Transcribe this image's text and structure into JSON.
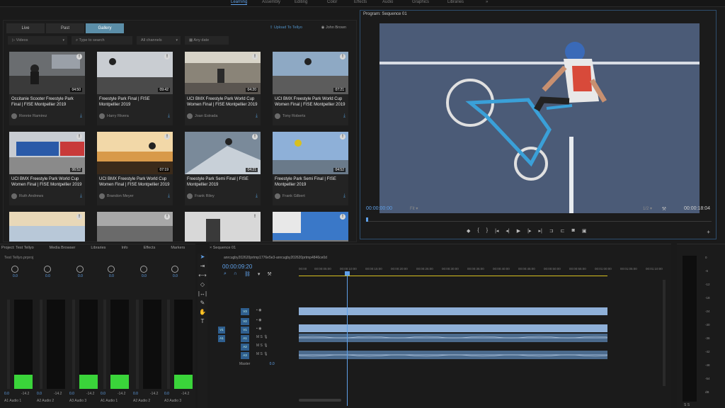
{
  "workspaces": [
    "Learning",
    "Assembly",
    "Editing",
    "Color",
    "Effects",
    "Audio",
    "Graphics",
    "Libraries",
    "»"
  ],
  "media": {
    "tabs": [
      "Live",
      "Past",
      "Gallery"
    ],
    "upload_label": "Upload To Tellyo",
    "user_label": "John Brown",
    "filters": {
      "type": "Videos",
      "search_placeholder": "Type to search",
      "channels": "All channels",
      "date": "Any date"
    },
    "cards": [
      {
        "title": "Occitanie Scooter Freestyle Park Final | FISE Montpellier 2019",
        "author": "Ronnie Ramirez",
        "duration": "04:50"
      },
      {
        "title": "Freestyle Park Final | FISE Montpellier 2019",
        "author": "Harry Rivera",
        "duration": "09:42"
      },
      {
        "title": "UCI BMX Freestyle Park World Cup Women Final | FISE Montpellier 2019",
        "author": "Joan Estrada",
        "duration": "04:20"
      },
      {
        "title": "UCI BMX Freestyle Park World Cup Women Final | FISE Montpellier 2019",
        "author": "Tony Roberts",
        "duration": "07:21"
      },
      {
        "title": "UCI BMX Freestyle Park World Cup Women Final | FISE Montpellier 2019",
        "author": "Ruth Andrews",
        "duration": "06:52"
      },
      {
        "title": "UCI BMX Freestyle Park World Cup Women Final | FISE Montpellier 2019",
        "author": "Brandon Meyer",
        "duration": "07:19"
      },
      {
        "title": "Freestyle Park Semi Final | FISE Montpellier 2019",
        "author": "Frank Riley",
        "duration": "04:21"
      },
      {
        "title": "Freestyle Park Semi Final | FISE Montpellier 2019",
        "author": "Frank Gilbert",
        "duration": "04:52"
      },
      {
        "title": "",
        "author": "",
        "duration": ""
      },
      {
        "title": "",
        "author": "",
        "duration": ""
      },
      {
        "title": "",
        "author": "",
        "duration": ""
      },
      {
        "title": "",
        "author": "",
        "duration": ""
      }
    ]
  },
  "program": {
    "title": "Program: Sequence 01",
    "timecode": "00:00:00:00",
    "fit": "Fit",
    "resolution": "1/2",
    "duration": "00:00:18:04"
  },
  "mixer": {
    "tabs": [
      "Project: Test Tellyo",
      "Media Browser",
      "Libraries",
      "Info",
      "Effects",
      "Markers"
    ],
    "project_file": "Test Tellyo.prproj",
    "channels": [
      {
        "name": "Audio 1",
        "id": "A1",
        "knob": "0.0",
        "val": "0.0",
        "val2": "-14.2",
        "level": 0.16
      },
      {
        "name": "Audio 2",
        "id": "A2",
        "knob": "0.0",
        "val": "0.0",
        "val2": "-14.2",
        "level": 0.0
      },
      {
        "name": "Audio 3",
        "id": "A3",
        "knob": "0.0",
        "val": "0.0",
        "val2": "-14.2",
        "level": 0.16
      },
      {
        "name": "Audio 1",
        "id": "A1",
        "knob": "0.0",
        "val": "0.0",
        "val2": "-14.2",
        "level": 0.16
      },
      {
        "name": "Audio 2",
        "id": "A2",
        "knob": "0.0",
        "val": "0.0",
        "val2": "-14.2",
        "level": 0.0
      },
      {
        "name": "Audio 3",
        "id": "A3",
        "knob": "0.0",
        "val": "0.0",
        "val2": "-14.2",
        "level": 0.16
      }
    ]
  },
  "timeline": {
    "tab": "Sequence 01",
    "sequence_name": "anrcugby202620prtmp1776e5e3-anrcugby202620prtmp4846ce0d",
    "timecode": "00:00:09:20",
    "ruler": [
      "00:00",
      "00:00:05:00",
      "00:00:10:00",
      "00:00:15:00",
      "00:00:20:00",
      "00:00:25:00",
      "00:00:30:00",
      "00:00:35:00",
      "00:00:40:00",
      "00:00:45:00",
      "00:00:50:00",
      "00:00:55:00",
      "00:01:00:00",
      "00:01:05:00",
      "00:01:10:00"
    ],
    "tracks": [
      "V3",
      "V2",
      "V1",
      "A1",
      "A2",
      "A3"
    ],
    "source_targets": [
      "V1",
      "A1"
    ],
    "master_label": "Master",
    "master_value": "0.0"
  },
  "vu_scale": [
    "0",
    "-6",
    "-12",
    "-18",
    "-24",
    "-30",
    "-36",
    "-42",
    "-48",
    "-54",
    "dB"
  ],
  "colors": {
    "accent": "#5fa0e8",
    "meter": "#3ad43a",
    "clip_video": "#8fb0d8",
    "clip_audio": "#4b6a8c"
  }
}
